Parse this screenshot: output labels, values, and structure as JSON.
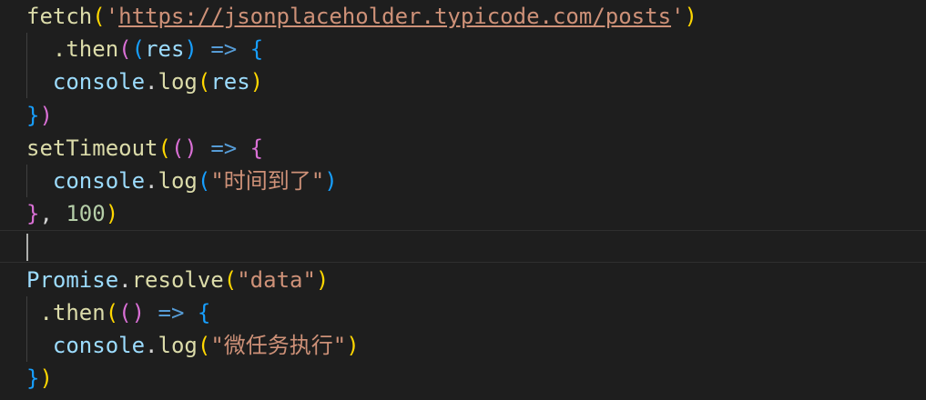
{
  "editor": {
    "lines": [
      {
        "tokens": [
          {
            "t": "fetch",
            "c": "fn"
          },
          {
            "t": "(",
            "c": "b1"
          },
          {
            "t": "'",
            "c": "str"
          },
          {
            "t": "https://jsonplaceholder.typicode.com/posts",
            "c": "url"
          },
          {
            "t": "'",
            "c": "str"
          },
          {
            "t": ")",
            "c": "b1"
          }
        ]
      },
      {
        "guides": [
          29
        ],
        "tokens": [
          {
            "t": "  .then",
            "c": "fn"
          },
          {
            "t": "(",
            "c": "b2"
          },
          {
            "t": "(",
            "c": "b3"
          },
          {
            "t": "res",
            "c": "var"
          },
          {
            "t": ")",
            "c": "b3"
          },
          {
            "t": " ",
            "c": "pun"
          },
          {
            "t": "=>",
            "c": "kw"
          },
          {
            "t": " ",
            "c": "pun"
          },
          {
            "t": "{",
            "c": "b3"
          }
        ]
      },
      {
        "guides": [
          29
        ],
        "tokens": [
          {
            "t": "  console",
            "c": "var"
          },
          {
            "t": ".",
            "c": "pun"
          },
          {
            "t": "log",
            "c": "fn"
          },
          {
            "t": "(",
            "c": "b1"
          },
          {
            "t": "res",
            "c": "var"
          },
          {
            "t": ")",
            "c": "b1"
          }
        ]
      },
      {
        "tokens": [
          {
            "t": "}",
            "c": "b3"
          },
          {
            "t": ")",
            "c": "b2"
          }
        ]
      },
      {
        "tokens": [
          {
            "t": "setTimeout",
            "c": "fn"
          },
          {
            "t": "(",
            "c": "b1"
          },
          {
            "t": "(",
            "c": "b2"
          },
          {
            "t": ")",
            "c": "b2"
          },
          {
            "t": " ",
            "c": "pun"
          },
          {
            "t": "=>",
            "c": "kw"
          },
          {
            "t": " ",
            "c": "pun"
          },
          {
            "t": "{",
            "c": "b2"
          }
        ]
      },
      {
        "guides": [
          29
        ],
        "tokens": [
          {
            "t": "  console",
            "c": "var"
          },
          {
            "t": ".",
            "c": "pun"
          },
          {
            "t": "log",
            "c": "fn"
          },
          {
            "t": "(",
            "c": "b3"
          },
          {
            "t": "\"时间到了\"",
            "c": "str"
          },
          {
            "t": ")",
            "c": "b3"
          }
        ]
      },
      {
        "tokens": [
          {
            "t": "}",
            "c": "b2"
          },
          {
            "t": ", ",
            "c": "pun"
          },
          {
            "t": "100",
            "c": "num"
          },
          {
            "t": ")",
            "c": "b1"
          }
        ]
      },
      {
        "current": true,
        "caret": true,
        "tokens": []
      },
      {
        "tokens": [
          {
            "t": "Promise",
            "c": "var"
          },
          {
            "t": ".",
            "c": "pun"
          },
          {
            "t": "resolve",
            "c": "fn"
          },
          {
            "t": "(",
            "c": "b1"
          },
          {
            "t": "\"data\"",
            "c": "str"
          },
          {
            "t": ")",
            "c": "b1"
          }
        ]
      },
      {
        "guides": [
          29
        ],
        "tokens": [
          {
            "t": " .then",
            "c": "fn"
          },
          {
            "t": "(",
            "c": "b1"
          },
          {
            "t": "(",
            "c": "b2"
          },
          {
            "t": ")",
            "c": "b2"
          },
          {
            "t": " ",
            "c": "pun"
          },
          {
            "t": "=>",
            "c": "kw"
          },
          {
            "t": " ",
            "c": "pun"
          },
          {
            "t": "{",
            "c": "b3"
          }
        ]
      },
      {
        "guides": [
          29
        ],
        "tokens": [
          {
            "t": "  console",
            "c": "var"
          },
          {
            "t": ".",
            "c": "pun"
          },
          {
            "t": "log",
            "c": "fn"
          },
          {
            "t": "(",
            "c": "b1"
          },
          {
            "t": "\"微任务执行\"",
            "c": "str"
          },
          {
            "t": ")",
            "c": "b1"
          }
        ]
      },
      {
        "tokens": [
          {
            "t": "}",
            "c": "b3"
          },
          {
            "t": ")",
            "c": "b1"
          }
        ]
      }
    ]
  }
}
